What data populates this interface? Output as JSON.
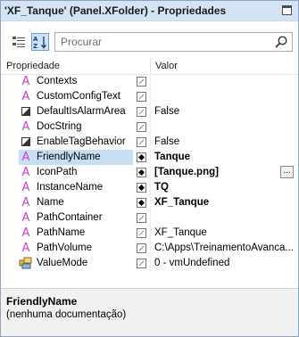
{
  "window": {
    "title": "'XF_Tanque' (Panel.XFolder) - Propriedades"
  },
  "toolbar": {
    "categorized_button": "categorized-view",
    "alphabetical_button": "alphabetical-view",
    "search_placeholder": "Procurar"
  },
  "grid": {
    "col_property": "Propriedade",
    "col_value": "Valor",
    "rows": [
      {
        "icon": "attribute-A",
        "name": "Contexts",
        "value": "",
        "bold": false,
        "flag": "empty"
      },
      {
        "icon": "attribute-A",
        "name": "CustomConfigText",
        "value": "",
        "bold": false,
        "flag": "empty"
      },
      {
        "icon": "boolean",
        "name": "DefaultIsAlarmArea",
        "value": "False",
        "bold": false,
        "flag": "empty"
      },
      {
        "icon": "attribute-A",
        "name": "DocString",
        "value": "",
        "bold": false,
        "flag": "empty"
      },
      {
        "icon": "boolean",
        "name": "EnableTagBehavior",
        "value": "False",
        "bold": false,
        "flag": "empty"
      },
      {
        "icon": "attribute-A",
        "name": "FriendlyName",
        "value": "Tanque",
        "bold": true,
        "flag": "diamond",
        "selected": true
      },
      {
        "icon": "attribute-A",
        "name": "IconPath",
        "value": "[Tanque.png]",
        "bold": true,
        "flag": "diamond",
        "ellipsis": "..."
      },
      {
        "icon": "attribute-A",
        "name": "InstanceName",
        "value": "TQ",
        "bold": true,
        "flag": "diamond"
      },
      {
        "icon": "attribute-A",
        "name": "Name",
        "value": "XF_Tanque",
        "bold": true,
        "flag": "diamond"
      },
      {
        "icon": "attribute-A",
        "name": "PathContainer",
        "value": "",
        "bold": false,
        "flag": "empty"
      },
      {
        "icon": "attribute-A",
        "name": "PathName",
        "value": "XF_Tanque",
        "bold": false,
        "flag": "empty"
      },
      {
        "icon": "attribute-A",
        "name": "PathVolume",
        "value": "C:\\Apps\\TreinamentoAvanca...",
        "bold": false,
        "flag": "empty"
      },
      {
        "icon": "enum",
        "name": "ValueMode",
        "value": "0 - vmUndefined",
        "bold": false,
        "flag": "empty"
      }
    ]
  },
  "description": {
    "title": "FriendlyName",
    "text": "(nenhuma documentação)"
  }
}
